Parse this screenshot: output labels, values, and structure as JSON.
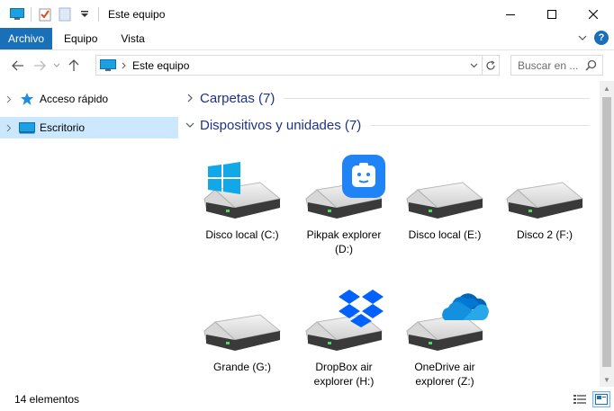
{
  "window": {
    "title": "Este equipo"
  },
  "ribbon": {
    "tabs": [
      {
        "label": "Archivo"
      },
      {
        "label": "Equipo"
      },
      {
        "label": "Vista"
      }
    ],
    "help_label": "?"
  },
  "address": {
    "path": "Este equipo",
    "search_placeholder": "Buscar en ..."
  },
  "nav_pane": {
    "items": [
      {
        "label": "Acceso rápido",
        "icon": "star-icon"
      },
      {
        "label": "Escritorio",
        "icon": "desktop-icon",
        "selected": true
      }
    ]
  },
  "content": {
    "groups": [
      {
        "title": "Carpetas (7)",
        "expanded": false
      },
      {
        "title": "Dispositivos y unidades (7)",
        "expanded": true
      }
    ],
    "drives": [
      {
        "label": "Disco local (C:)",
        "overlay": "windows-logo-icon"
      },
      {
        "label": "Pikpak explorer (D:)",
        "overlay": "pikpak-logo-icon"
      },
      {
        "label": "Disco local (E:)",
        "overlay": ""
      },
      {
        "label": "Disco 2 (F:)",
        "overlay": ""
      },
      {
        "label": "Grande (G:)",
        "overlay": ""
      },
      {
        "label": "DropBox air explorer (H:)",
        "overlay": "dropbox-logo-icon"
      },
      {
        "label": "OneDrive air explorer (Z:)",
        "overlay": "onedrive-logo-icon"
      }
    ]
  },
  "status": {
    "count_text": "14 elementos"
  },
  "colors": {
    "accent": "#1a6fb9",
    "group_title": "#1e3287",
    "selection": "#cce8ff"
  }
}
